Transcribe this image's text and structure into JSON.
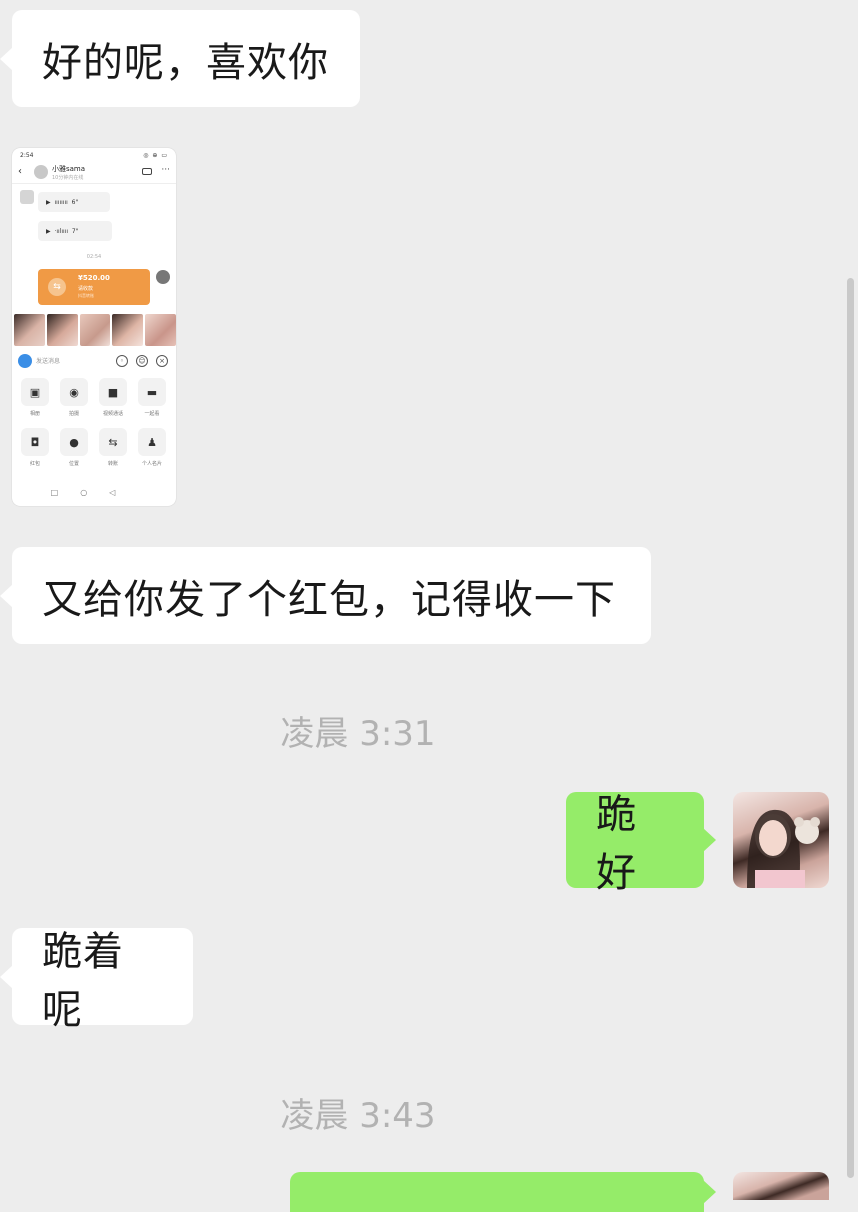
{
  "messages": {
    "m1": "好的呢，喜欢你",
    "m2": "又给你发了个红包，记得收一下",
    "m3": "跪好",
    "m4": "跪着呢"
  },
  "timestamps": {
    "t1": "凌晨 3:31",
    "t2": "凌晨 3:43"
  },
  "colors": {
    "incoming_bubble": "#ffffff",
    "outgoing_bubble": "#95ec69",
    "background": "#ededed"
  },
  "screenshot": {
    "status_time": "2:54",
    "status_icons": "◎ ⊕ ▭",
    "contact_name": "小雅sama",
    "contact_status": "10分钟内在线",
    "voice1": "6\"",
    "voice2": "7\"",
    "time": "02:54",
    "red_amount": "¥520.00",
    "red_label": "请收款",
    "red_note": "抖音转账",
    "input_placeholder": "发送消息",
    "tools": [
      "相册",
      "拍摄",
      "视频通话",
      "一起看",
      "红包",
      "位置",
      "转账",
      "个人名片"
    ],
    "icons": [
      "picture-icon",
      "camera-icon",
      "video-icon",
      "sofa-icon",
      "envelope-icon",
      "location-icon",
      "transfer-icon",
      "person-icon"
    ]
  }
}
